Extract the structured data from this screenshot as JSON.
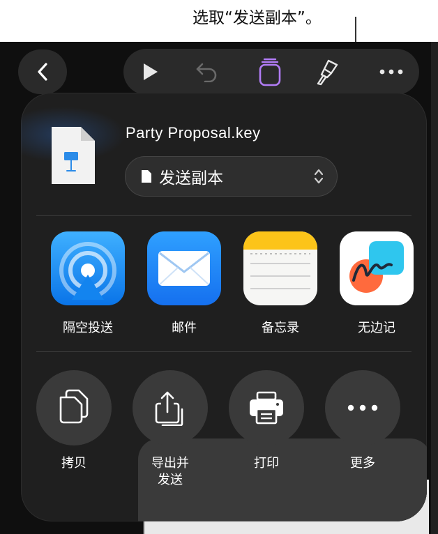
{
  "callout": {
    "text": "选取“发送副本”。"
  },
  "toolbar": {
    "back_icon": "chevron-left-icon",
    "icons": [
      "play-icon",
      "undo-icon",
      "document-stack-icon",
      "paintbrush-icon",
      "more-icon"
    ],
    "active_color": "#b17cf5"
  },
  "share_sheet": {
    "file_name": "Party Proposal.key",
    "send_option": "发送副本",
    "apps": [
      {
        "label": "隔空投送",
        "icon": "airdrop-icon"
      },
      {
        "label": "邮件",
        "icon": "mail-icon"
      },
      {
        "label": "备忘录",
        "icon": "notes-icon"
      },
      {
        "label": "无边记",
        "icon": "freeform-icon"
      }
    ],
    "actions": [
      {
        "label": "拷贝",
        "icon": "copy-icon"
      },
      {
        "label": "导出并\n发送",
        "icon": "export-icon"
      },
      {
        "label": "打印",
        "icon": "printer-icon"
      },
      {
        "label": "更多",
        "icon": "ellipsis-icon"
      }
    ]
  }
}
